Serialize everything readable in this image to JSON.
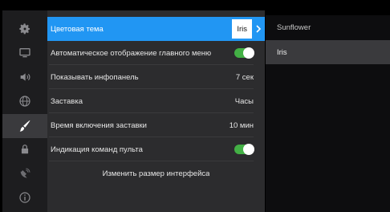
{
  "settings": {
    "rows": [
      {
        "label": "Цветовая тема",
        "value": "Iris",
        "type": "select",
        "selected": true
      },
      {
        "label": "Автоматическое отображение главного меню",
        "type": "toggle",
        "on": true
      },
      {
        "label": "Показывать инфопанель",
        "value": "7 сек",
        "type": "value"
      },
      {
        "label": "Заставка",
        "value": "Часы",
        "type": "value"
      },
      {
        "label": "Время включения заставки",
        "value": "10 мин",
        "type": "value"
      },
      {
        "label": "Индикация команд пульта",
        "type": "toggle",
        "on": true
      },
      {
        "label": "Изменить размер интерфейса",
        "type": "action"
      }
    ]
  },
  "theme_options": [
    {
      "label": "Sunflower",
      "highlighted": false
    },
    {
      "label": "Iris",
      "highlighted": true
    }
  ],
  "rail_icons": [
    "gear-icon",
    "monitor-icon",
    "volume-icon",
    "globe-icon",
    "brush-icon",
    "lock-icon",
    "satellite-dish-icon",
    "info-icon"
  ],
  "colors": {
    "accent": "#2196f3",
    "toggle_on": "#43b045",
    "panel": "#2c2c2e",
    "rail": "#1d1d1f"
  }
}
